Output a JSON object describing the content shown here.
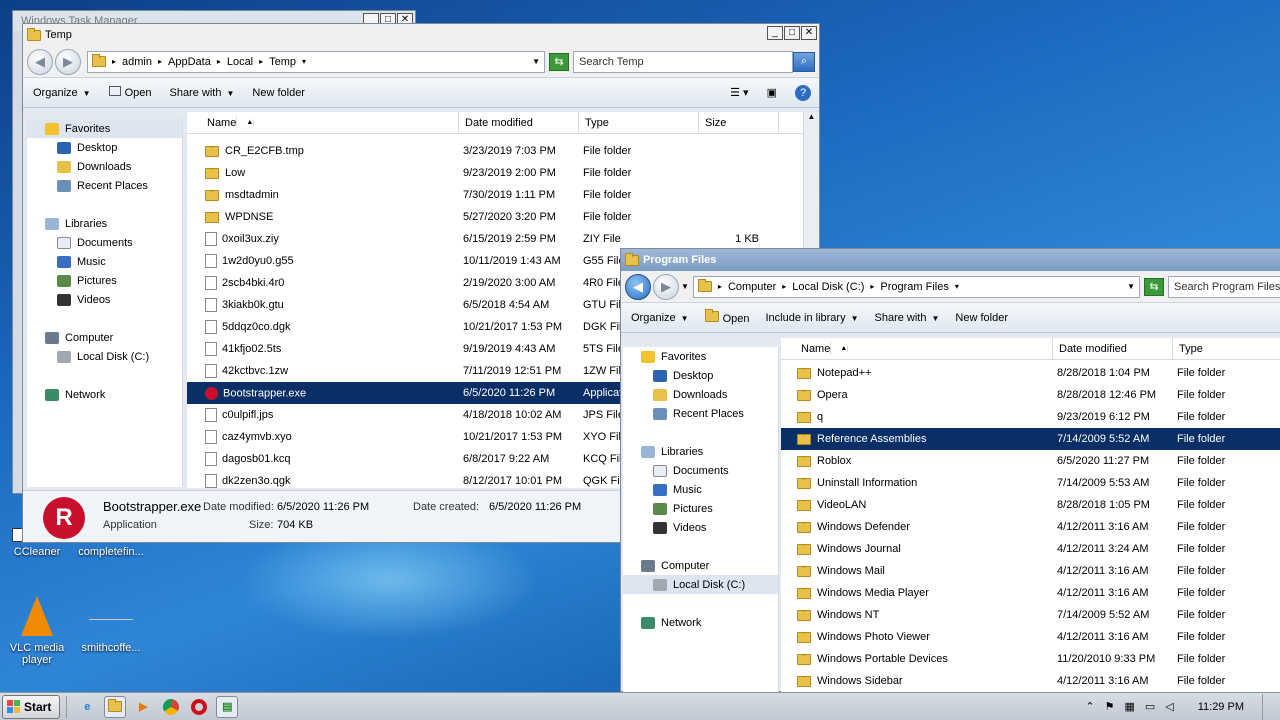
{
  "bg_window": {
    "title": "Windows Task Manager"
  },
  "temp": {
    "title": "Temp",
    "crumbs": [
      "admin",
      "AppData",
      "Local",
      "Temp"
    ],
    "search_placeholder": "Search Temp",
    "cmd": {
      "organize": "Organize",
      "open": "Open",
      "share": "Share with",
      "new_folder": "New folder"
    },
    "nav": {
      "favorites": "Favorites",
      "items_fav": [
        "Desktop",
        "Downloads",
        "Recent Places"
      ],
      "libraries": "Libraries",
      "items_lib": [
        "Documents",
        "Music",
        "Pictures",
        "Videos"
      ],
      "computer": "Computer",
      "disk": "Local Disk (C:)",
      "network": "Network"
    },
    "cols": {
      "name": "Name",
      "date": "Date modified",
      "type": "Type",
      "size": "Size"
    },
    "rows": [
      {
        "name": "CR_E2CFB.tmp",
        "date": "3/23/2019 7:03 PM",
        "type": "File folder",
        "size": "",
        "folder": true
      },
      {
        "name": "Low",
        "date": "9/23/2019 2:00 PM",
        "type": "File folder",
        "size": "",
        "folder": true
      },
      {
        "name": "msdtadmin",
        "date": "7/30/2019 1:11 PM",
        "type": "File folder",
        "size": "",
        "folder": true
      },
      {
        "name": "WPDNSE",
        "date": "5/27/2020 3:20 PM",
        "type": "File folder",
        "size": "",
        "folder": true
      },
      {
        "name": "0xoil3ux.ziy",
        "date": "6/15/2019 2:59 PM",
        "type": "ZIY File",
        "size": "1 KB"
      },
      {
        "name": "1w2d0yu0.g55",
        "date": "10/11/2019 1:43 AM",
        "type": "G55 File",
        "size": ""
      },
      {
        "name": "2scb4bki.4r0",
        "date": "2/19/2020 3:00 AM",
        "type": "4R0 File",
        "size": ""
      },
      {
        "name": "3kiakb0k.gtu",
        "date": "6/5/2018 4:54 AM",
        "type": "GTU File",
        "size": ""
      },
      {
        "name": "5ddqz0co.dgk",
        "date": "10/21/2017 1:53 PM",
        "type": "DGK File",
        "size": ""
      },
      {
        "name": "41kfjo02.5ts",
        "date": "9/19/2019 4:43 AM",
        "type": "5TS File",
        "size": ""
      },
      {
        "name": "42kctbvc.1zw",
        "date": "7/11/2019 12:51 PM",
        "type": "1ZW File",
        "size": ""
      },
      {
        "name": "Bootstrapper.exe",
        "date": "6/5/2020 11:26 PM",
        "type": "Application",
        "size": "",
        "sel": true,
        "exe": true
      },
      {
        "name": "c0ulpifl.jps",
        "date": "4/18/2018 10:02 AM",
        "type": "JPS File",
        "size": ""
      },
      {
        "name": "caz4ymvb.xyo",
        "date": "10/21/2017 1:53 PM",
        "type": "XYO File",
        "size": ""
      },
      {
        "name": "dagosb01.kcq",
        "date": "6/8/2017 9:22 AM",
        "type": "KCQ File",
        "size": ""
      },
      {
        "name": "dk2zen3o.qgk",
        "date": "8/12/2017 10:01 PM",
        "type": "QGK File",
        "size": ""
      }
    ],
    "details": {
      "name": "Bootstrapper.exe",
      "kind": "Application",
      "modified_label": "Date modified:",
      "modified": "6/5/2020 11:26 PM",
      "size_label": "Size:",
      "size": "704 KB",
      "created_label": "Date created:",
      "created": "6/5/2020 11:26 PM"
    }
  },
  "pf": {
    "title": "Program Files",
    "crumbs": [
      "Computer",
      "Local Disk (C:)",
      "Program Files"
    ],
    "search_placeholder": "Search Program Files",
    "cmd": {
      "organize": "Organize",
      "open": "Open",
      "include": "Include in library",
      "share": "Share with",
      "new_folder": "New folder"
    },
    "nav": {
      "favorites": "Favorites",
      "items_fav": [
        "Desktop",
        "Downloads",
        "Recent Places"
      ],
      "libraries": "Libraries",
      "items_lib": [
        "Documents",
        "Music",
        "Pictures",
        "Videos"
      ],
      "computer": "Computer",
      "disk": "Local Disk (C:)",
      "network": "Network"
    },
    "cols": {
      "name": "Name",
      "date": "Date modified",
      "type": "Type"
    },
    "rows": [
      {
        "name": "Notepad++",
        "date": "8/28/2018 1:04 PM",
        "type": "File folder"
      },
      {
        "name": "Opera",
        "date": "8/28/2018 12:46 PM",
        "type": "File folder"
      },
      {
        "name": "q",
        "date": "9/23/2019 6:12 PM",
        "type": "File folder"
      },
      {
        "name": "Reference Assemblies",
        "date": "7/14/2009 5:52 AM",
        "type": "File folder",
        "sel": true
      },
      {
        "name": "Roblox",
        "date": "6/5/2020 11:27 PM",
        "type": "File folder"
      },
      {
        "name": "Uninstall Information",
        "date": "7/14/2009 5:53 AM",
        "type": "File folder"
      },
      {
        "name": "VideoLAN",
        "date": "8/28/2018 1:05 PM",
        "type": "File folder"
      },
      {
        "name": "Windows Defender",
        "date": "4/12/2011 3:16 AM",
        "type": "File folder"
      },
      {
        "name": "Windows Journal",
        "date": "4/12/2011 3:24 AM",
        "type": "File folder"
      },
      {
        "name": "Windows Mail",
        "date": "4/12/2011 3:16 AM",
        "type": "File folder"
      },
      {
        "name": "Windows Media Player",
        "date": "4/12/2011 3:16 AM",
        "type": "File folder"
      },
      {
        "name": "Windows NT",
        "date": "7/14/2009 5:52 AM",
        "type": "File folder"
      },
      {
        "name": "Windows Photo Viewer",
        "date": "4/12/2011 3:16 AM",
        "type": "File folder"
      },
      {
        "name": "Windows Portable Devices",
        "date": "11/20/2010 9:33 PM",
        "type": "File folder"
      },
      {
        "name": "Windows Sidebar",
        "date": "4/12/2011 3:16 AM",
        "type": "File folder"
      }
    ]
  },
  "desktop_icons": [
    {
      "label": "CCleaner"
    },
    {
      "label": "completefin..."
    },
    {
      "label": "VLC media player"
    },
    {
      "label": "smithcoffe..."
    }
  ],
  "taskbar": {
    "start": "Start",
    "clock": "11:29 PM"
  }
}
